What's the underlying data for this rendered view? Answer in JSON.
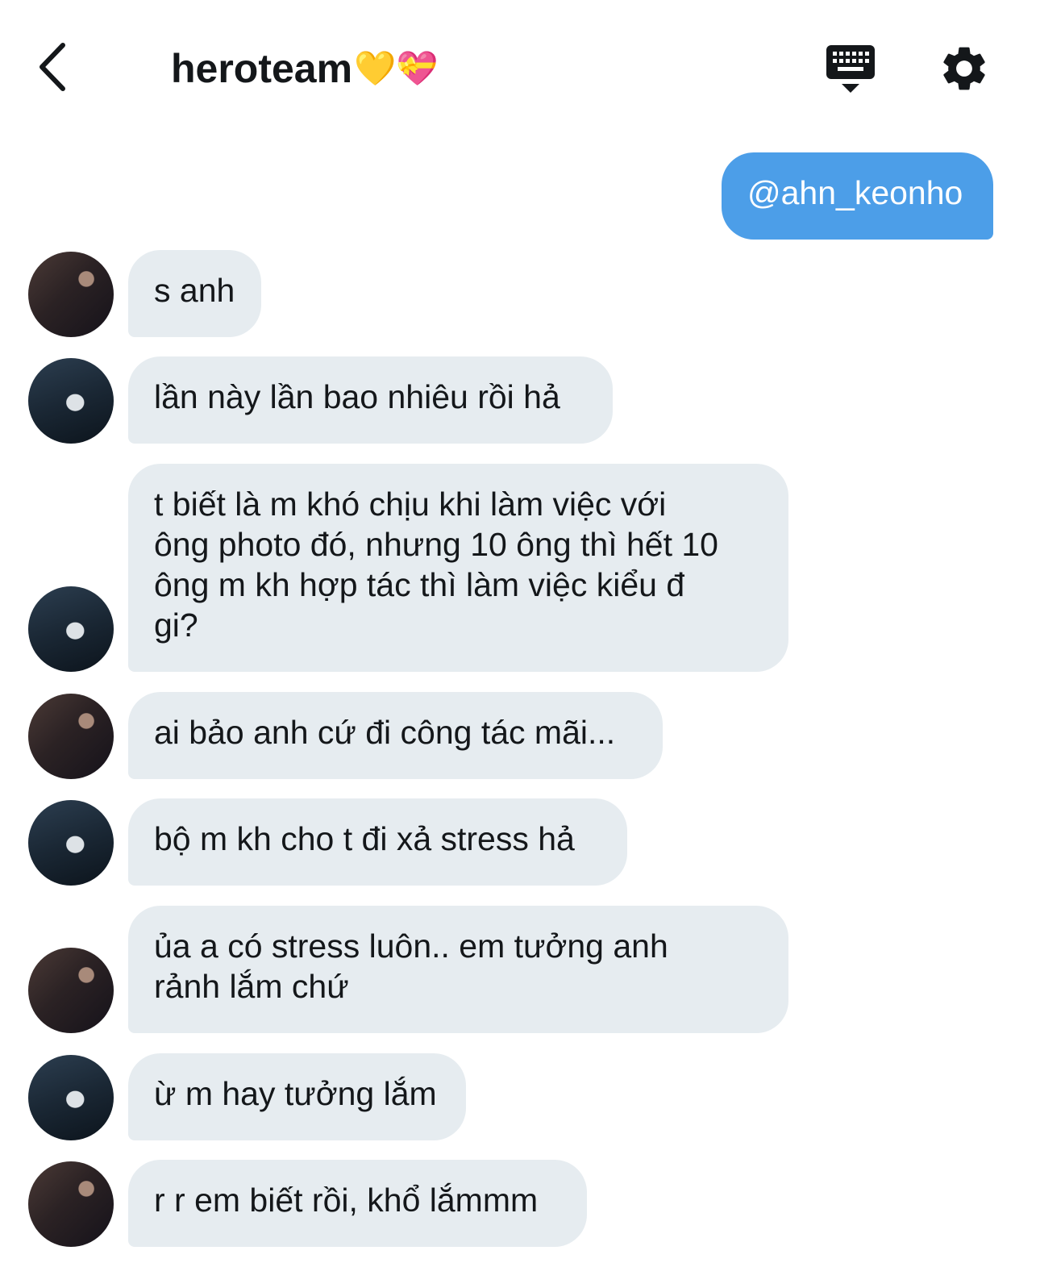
{
  "header": {
    "title": "heroteam",
    "title_emojis": "💛💝",
    "icons": [
      "back-chevron-icon",
      "keyboard-icon",
      "gear-icon"
    ]
  },
  "messages": [
    {
      "direction": "out",
      "text": "@ahn_keonho"
    },
    {
      "direction": "in",
      "avatar": "a1",
      "text": "s anh"
    },
    {
      "direction": "in",
      "avatar": "a2",
      "text": "lần này lần bao nhiêu rồi hả"
    },
    {
      "direction": "in",
      "avatar": "a2",
      "lines": [
        "t biết là m khó chịu khi làm việc với",
        "ông photo đó, nhưng 10 ông thì hết 10",
        "ông m kh hợp tác thì làm việc kiểu đ",
        "gi?"
      ]
    },
    {
      "direction": "in",
      "avatar": "a1",
      "text": "ai bảo anh cứ đi công tác mãi..."
    },
    {
      "direction": "in",
      "avatar": "a2",
      "text": "bộ m kh cho t đi xả stress hả"
    },
    {
      "direction": "in",
      "avatar": "a1",
      "lines": [
        "ủa a có stress luôn.. em tưởng anh",
        "rảnh lắm chứ"
      ]
    },
    {
      "direction": "in",
      "avatar": "a2",
      "text": "ừ m hay tưởng lắm"
    },
    {
      "direction": "in",
      "avatar": "a1",
      "text": "r r em biết rồi, khổ lắmmm"
    }
  ],
  "colors": {
    "incoming_bubble": "#e6ecf0",
    "outgoing_bubble": "#4c9ee8",
    "text": "#14171a"
  }
}
